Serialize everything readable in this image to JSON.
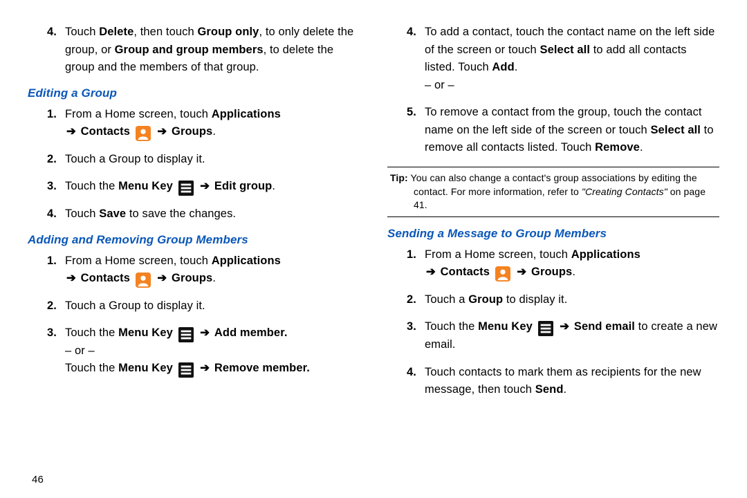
{
  "page_number": "46",
  "left": {
    "item4": {
      "num": "4.",
      "pre": "Touch ",
      "b1": "Delete",
      "mid1": ", then touch ",
      "b2": "Group only",
      "mid2": ", to only delete the group, or ",
      "b3": "Group and group members",
      "post": ", to delete the group and the members of that group."
    },
    "h1": "Editing a Group",
    "edit": {
      "s1": {
        "num": "1.",
        "pre": "From a Home screen, touch ",
        "b1": "Applications",
        "arrow1": "➔",
        "b2": "Contacts",
        "arrow2": "➔",
        "b3": "Groups",
        "dot": "."
      },
      "s2": {
        "num": "2.",
        "text": "Touch a Group to display it."
      },
      "s3": {
        "num": "3.",
        "pre": "Touch the ",
        "b1": "Menu Key",
        "arrow": "➔",
        "b2": "Edit group",
        "dot": "."
      },
      "s4": {
        "num": "4.",
        "pre": "Touch ",
        "b1": "Save",
        "post": " to save the changes."
      }
    },
    "h2": "Adding and Removing Group Members",
    "addrem": {
      "s1": {
        "num": "1.",
        "pre": "From a Home screen, touch ",
        "b1": "Applications",
        "arrow1": "➔",
        "b2": "Contacts",
        "arrow2": "➔",
        "b3": "Groups",
        "dot": "."
      },
      "s2": {
        "num": "2.",
        "text": "Touch a Group to display it."
      },
      "s3": {
        "num": "3.",
        "pre": "Touch the ",
        "b1": "Menu Key",
        "arrow": "➔",
        "b2": "Add member.",
        "or": "– or –",
        "pre2": "Touch the ",
        "b3": "Menu Key",
        "arrow2": "➔",
        "b4": "Remove member."
      }
    }
  },
  "right": {
    "item4": {
      "num": "4.",
      "pre": "To add a contact, touch the contact name on the left side of the screen or touch ",
      "b1": "Select all",
      "mid": " to add all contacts listed. Touch ",
      "b2": "Add",
      "dot": ".",
      "or": "– or –"
    },
    "item5": {
      "num": "5.",
      "pre": "To remove a contact from the group, touch the contact name on the left side of the screen or touch ",
      "b1": "Select all",
      "mid": " to remove all contacts listed. Touch ",
      "b2": "Remove",
      "dot": "."
    },
    "tip": {
      "label": "Tip:",
      "line1": " You can also change a contact's group associations by editing the",
      "line2a": "contact. For more information, refer to ",
      "ref": "\"Creating Contacts\"",
      "line2b": " on page 41."
    },
    "h1": "Sending a Message to Group Members",
    "send": {
      "s1": {
        "num": "1.",
        "pre": "From a Home screen, touch ",
        "b1": "Applications",
        "arrow1": "➔",
        "b2": "Contacts",
        "arrow2": "➔",
        "b3": "Groups",
        "dot": "."
      },
      "s2": {
        "num": "2.",
        "pre": "Touch a ",
        "b1": "Group",
        "post": " to display it."
      },
      "s3": {
        "num": "3.",
        "pre": "Touch the ",
        "b1": "Menu Key",
        "arrow": "➔",
        "b2": "Send email",
        "post": " to create a new email."
      },
      "s4": {
        "num": "4.",
        "pre": "Touch contacts to mark them as recipients for the new message, then touch ",
        "b1": "Send",
        "dot": "."
      }
    }
  }
}
